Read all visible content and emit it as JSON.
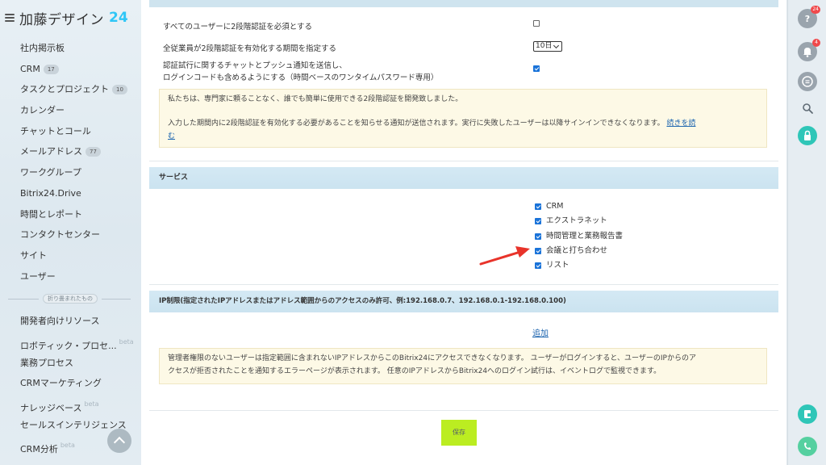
{
  "app": {
    "logo_text": "加藤デザイン",
    "logo_number": "24"
  },
  "sidebar": {
    "items": [
      {
        "label": "社内掲示板"
      },
      {
        "label": "CRM",
        "badge": "17"
      },
      {
        "label": "タスクとプロジェクト",
        "badge": "10"
      },
      {
        "label": "カレンダー"
      },
      {
        "label": "チャットとコール"
      },
      {
        "label": "メールアドレス",
        "badge": "77"
      },
      {
        "label": "ワークグループ"
      },
      {
        "label": "Bitrix24.Drive"
      },
      {
        "label": "時間とレポート"
      },
      {
        "label": "コンタクトセンター"
      },
      {
        "label": "サイト"
      },
      {
        "label": "ユーザー"
      }
    ],
    "collapsed_label": "折り畳まれたもの",
    "collapsed_items": [
      {
        "label": "開発者向けリソース"
      },
      {
        "label": "ロボティック・プロセ...",
        "beta": "beta"
      },
      {
        "label": "業務プロセス"
      },
      {
        "label": "CRMマーケティング"
      },
      {
        "label": "ナレッジベース",
        "beta": "beta"
      },
      {
        "label": "セールスインテリジェンス"
      },
      {
        "label": "CRM分析",
        "beta": "beta"
      }
    ]
  },
  "rightbar": {
    "help_badge": "24",
    "notifications_badge": "4",
    "colors": {
      "grey": "#9aa4ad",
      "teal": "#2fc6b8",
      "green": "#55d0a0",
      "badge": "#f0494b"
    }
  },
  "security": {
    "require_2fa_label": "すべてのユーザーに2段階認証を必須とする",
    "require_2fa_checked": false,
    "period_label": "全従業員が2段階認証を有効化する期間を指定する",
    "period_value": "10日",
    "notify_label_line1": "認証試行に関するチャットとプッシュ通知を送信し、",
    "notify_label_line2": "ログインコードも含めるようにする（時間ベースのワンタイムパスワード専用）",
    "notify_checked": true,
    "note_line1": "私たちは、専門家に頼ることなく、誰でも簡単に使用できる2段階認証を開発致しました。",
    "note_line2": "入力した期間内に2段階認証を有効化する必要があることを知らせる通知が送信されます。実行に失敗したユーザーは以降サインインできなくなります。",
    "note_link_a": "続きを読",
    "note_link_b": "む"
  },
  "services": {
    "title": "サービス",
    "items": [
      {
        "label": "CRM",
        "checked": true
      },
      {
        "label": "エクストラネット",
        "checked": true
      },
      {
        "label": "時間管理と業務報告書",
        "checked": true
      },
      {
        "label": "会議と打ち合わせ",
        "checked": true
      },
      {
        "label": "リスト",
        "checked": true
      }
    ]
  },
  "ip": {
    "title": "IP制限(指定されたIPアドレスまたはアドレス範囲からのアクセスのみ許可、例:192.168.0.7、192.168.0.1-192.168.0.100)",
    "add_link": "追加",
    "note_line1": "管理者権限のないユーザーは指定範囲に含まれないIPアドレスからこのBitrix24にアクセスできなくなります。 ユーザーがログインすると、ユーザーのIPからのア",
    "note_line2": "クセスが拒否されたことを通知するエラーページが表示されます。 任意のIPアドレスからBitrix24へのログイン試行は、イベントログで監視できます。"
  },
  "footer": {
    "save_label": "保存"
  },
  "colors": {
    "accent": "#2fc6f6",
    "checkbox": "#1a73d9",
    "save_button": "#bbed21",
    "section_header": "#d4e9f4",
    "note_bg": "#fdf9e6",
    "arrow": "#e8332a"
  }
}
